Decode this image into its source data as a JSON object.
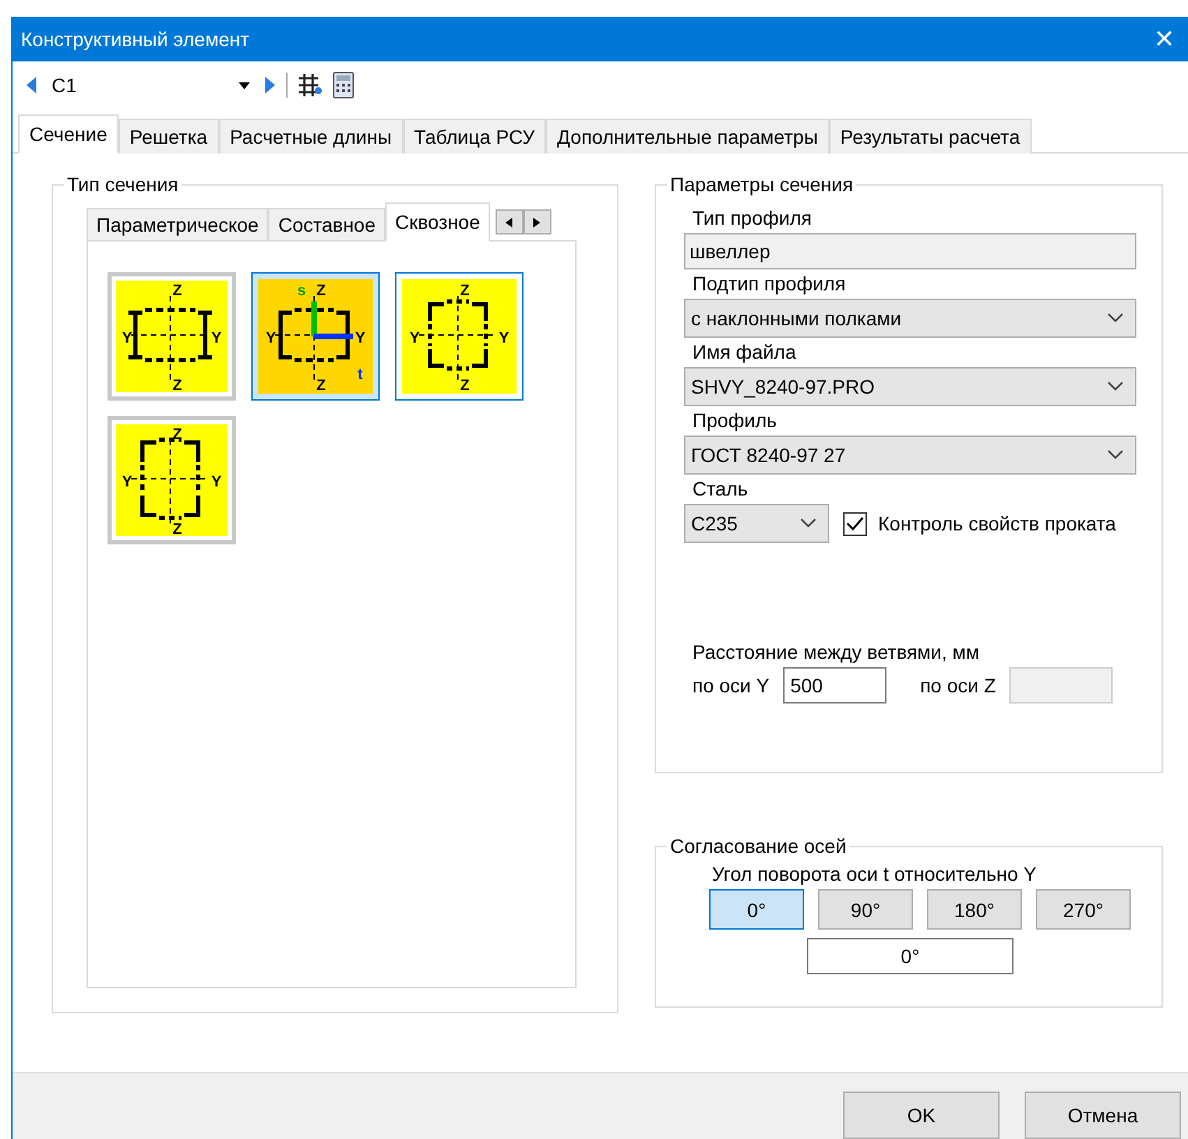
{
  "window": {
    "title": "Конструктивный элемент",
    "close": "✕"
  },
  "toolbar": {
    "element": "C1"
  },
  "tabs": [
    {
      "label": "Сечение",
      "selected": true
    },
    {
      "label": "Решетка",
      "selected": false
    },
    {
      "label": "Расчетные длины",
      "selected": false
    },
    {
      "label": "Таблица РСУ",
      "selected": false
    },
    {
      "label": "Дополнительные параметры",
      "selected": false
    },
    {
      "label": "Результаты расчета",
      "selected": false
    }
  ],
  "section_type": {
    "title": "Тип сечения",
    "tabs": [
      {
        "label": "Параметрическое",
        "selected": false
      },
      {
        "label": "Составное",
        "selected": false
      },
      {
        "label": "Сквозное",
        "selected": true
      }
    ],
    "tiles": [
      {
        "kind": "i-beams",
        "selected": false,
        "hovered": false,
        "labels": {
          "top": "Z",
          "left": "Y",
          "right": "Y",
          "bottom": "Z"
        }
      },
      {
        "kind": "channels",
        "selected": true,
        "hovered": false,
        "labels": {
          "s": "s",
          "top": "Z",
          "left": "Y",
          "right": "Y",
          "t": "t",
          "bottom": "Z"
        }
      },
      {
        "kind": "angles",
        "selected": false,
        "hovered": true,
        "labels": {
          "top": "Z",
          "left": "Y",
          "right": "Y",
          "bottom": "Z"
        }
      },
      {
        "kind": "angles-tall",
        "selected": false,
        "hovered": false,
        "labels": {
          "top": "Z",
          "left": "Y",
          "right": "Y",
          "bottom": "Z"
        }
      }
    ]
  },
  "section_params": {
    "title": "Параметры сечения",
    "profile_type": {
      "label": "Тип профиля",
      "value": "швеллер"
    },
    "profile_subtype": {
      "label": "Подтип профиля",
      "value": "с наклонными полками"
    },
    "file_name": {
      "label": "Имя файла",
      "value": "SHVY_8240-97.PRO"
    },
    "profile": {
      "label": "Профиль",
      "value": "ГОСТ 8240-97  27"
    },
    "steel": {
      "label": "Сталь",
      "value": "С235"
    },
    "rolled_check": {
      "label": "Контроль свойств проката",
      "checked": true
    },
    "distance": {
      "label": "Расстояние между ветвями, мм",
      "y_label": "по оси Y",
      "y_value": "500",
      "z_label": "по оси Z",
      "z_disabled": true
    }
  },
  "axes": {
    "title": "Согласование осей",
    "label": "Угол поворота оси t относительно Y",
    "angles": [
      {
        "label": "0°",
        "selected": true
      },
      {
        "label": "90°",
        "selected": false
      },
      {
        "label": "180°",
        "selected": false
      },
      {
        "label": "270°",
        "selected": false
      }
    ],
    "value": "0°"
  },
  "buttons": [
    "OK",
    "Отмена"
  ]
}
